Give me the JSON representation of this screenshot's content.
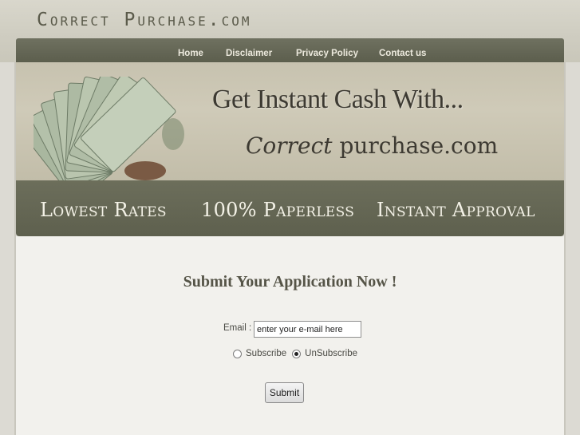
{
  "site": {
    "logo_text": "Correct Purchase.com"
  },
  "nav": {
    "items": [
      {
        "label": "Home"
      },
      {
        "label": "Disclaimer"
      },
      {
        "label": "Privacy Policy"
      },
      {
        "label": "Contact us"
      }
    ]
  },
  "hero": {
    "title": "Get Instant Cash With...",
    "sub_italic": "Correct ",
    "sub_plain": "purchase.com"
  },
  "features": {
    "items": [
      {
        "label": "Lowest Rates"
      },
      {
        "label": "100% Paperless"
      },
      {
        "label": "Instant Approval"
      }
    ]
  },
  "form": {
    "heading": "Submit Your Application Now !",
    "email_label": "Email :",
    "email_value": "enter your e-mail here",
    "radio_options": [
      {
        "label": "Subscribe",
        "checked": false
      },
      {
        "label": "UnSubscribe",
        "checked": true
      }
    ],
    "submit_label": "Submit"
  },
  "colors": {
    "nav_bg": "#5c5e4d",
    "features_bg": "#5e604e",
    "hero_bg": "#c7c2af",
    "content_bg": "#f2f1ed",
    "nav_text": "#ece9dd"
  },
  "icons": {
    "hero_image": "money-fan-icon"
  }
}
